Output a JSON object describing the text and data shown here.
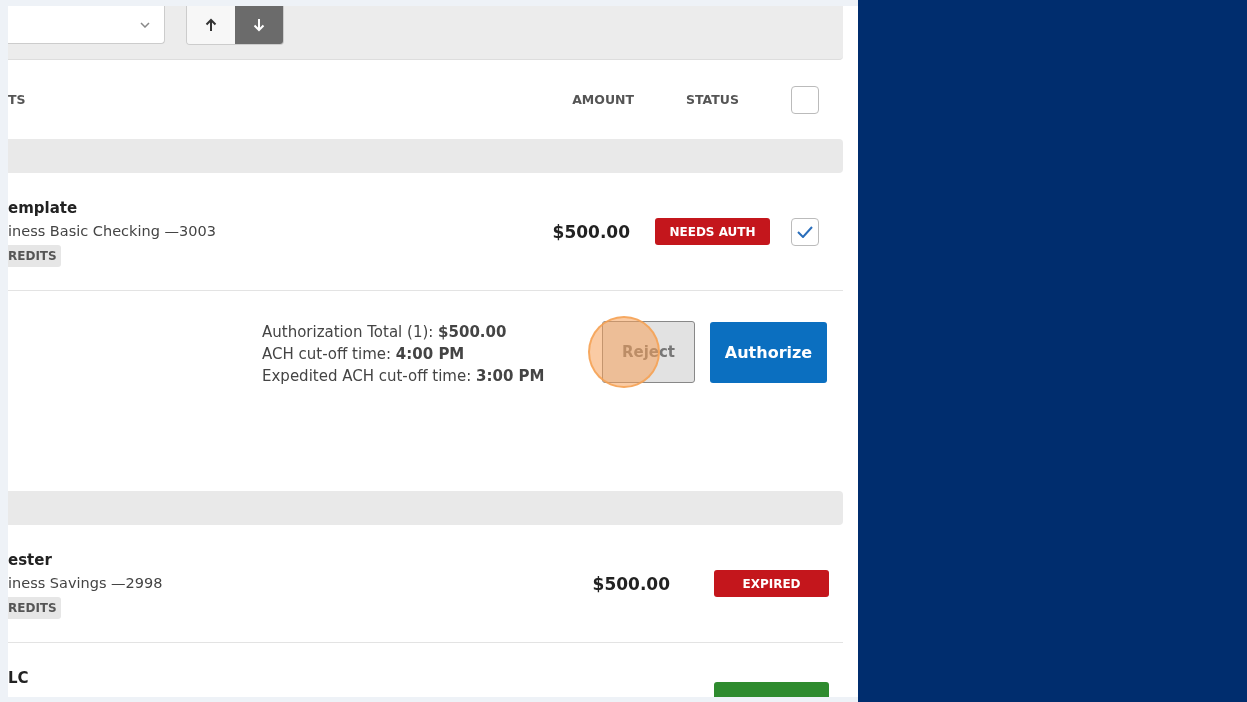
{
  "toolbar": {
    "sort_buttons": [
      {
        "kind": "ascending",
        "selected": false
      },
      {
        "kind": "descending",
        "selected": true
      }
    ]
  },
  "header": {
    "column_1": "TS",
    "amount": "AMOUNT",
    "status": "STATUS",
    "select_all": {
      "checked": false
    }
  },
  "groups": [
    {
      "rows": [
        {
          "kind": "selectable",
          "title": "emplate",
          "account": "iness Basic Checking —3003",
          "tag": "REDITS",
          "amount": "$500.00",
          "status": "NEEDS AUTH",
          "color": "#c4161c",
          "checked": true
        }
      ],
      "auth_panel": {
        "lines": [
          "Authorization Total (1): **$500.00**",
          "ACH cut-off time: **4:00 PM**",
          "Expedited ACH cut-off time: **3:00 PM**"
        ],
        "reject": "Reject",
        "authorize": "Authorize"
      }
    },
    {
      "rows": [
        {
          "kind": "final",
          "title": "ester",
          "account": "iness Savings —2998",
          "tag": "REDITS",
          "amount": "$500.00",
          "status": "EXPIRED",
          "color": "#c4161c"
        },
        {
          "kind": "final",
          "title": "LC",
          "color": "#2e8b2e"
        }
      ]
    }
  ]
}
